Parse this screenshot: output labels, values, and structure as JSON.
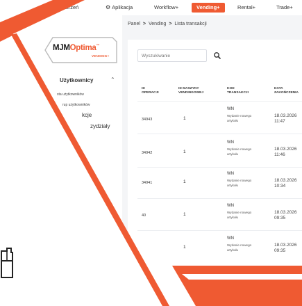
{
  "topnav": {
    "items": [
      {
        "label": "Moja przestrzeń"
      },
      {
        "label": "Aplikacja",
        "icon": "gear-icon"
      },
      {
        "label": "Workflow+"
      },
      {
        "label": "Vending+",
        "active": true
      },
      {
        "label": "Rental+"
      },
      {
        "label": "Trade+"
      }
    ]
  },
  "logo": {
    "mjm": "MJM",
    "optima": "Optima",
    "tm": "™",
    "sub": "VENDING+"
  },
  "sidebar": {
    "section_label": "Użytkownicy",
    "sub_items": [
      "sta użytkowników",
      "rup użytkowników"
    ],
    "items": [
      "kcje",
      "zydziały"
    ]
  },
  "breadcrumb": [
    "Panel",
    "Vending",
    "Lista transakcji"
  ],
  "search": {
    "placeholder": "Wyszukiwanie"
  },
  "table": {
    "columns": [
      "ID\nOPERACJI",
      "ID MASZYNY\nVENDINGOWEJ",
      "KOD\nTRANSAKCJI",
      "DATA\nZAKOŃCZENIA"
    ],
    "rows": [
      {
        "id": "34943",
        "machine": "1",
        "code": "WN",
        "desc": "Wydanie nowego\nartykułu",
        "date": "18.03.2026\n11:47"
      },
      {
        "id": "34942",
        "machine": "1",
        "code": "WN",
        "desc": "Wydanie nowego\nartykułu",
        "date": "18.03.2026\n11:46"
      },
      {
        "id": "34941",
        "machine": "1",
        "code": "WN",
        "desc": "Wydanie nowego\nartykułu",
        "date": "18.03.2026\n10:34"
      },
      {
        "id": "40",
        "machine": "1",
        "code": "WN",
        "desc": "Wydanie nowego\nartykułu",
        "date": "18.03.2026\n09:35"
      },
      {
        "id": "",
        "machine": "1",
        "code": "WN",
        "desc": "Wydanie nowego\nartykułu",
        "date": "18.03.2026\n09:35"
      }
    ]
  },
  "colors": {
    "accent": "#ef5a32",
    "panel_bg": "#f4f5f7"
  }
}
